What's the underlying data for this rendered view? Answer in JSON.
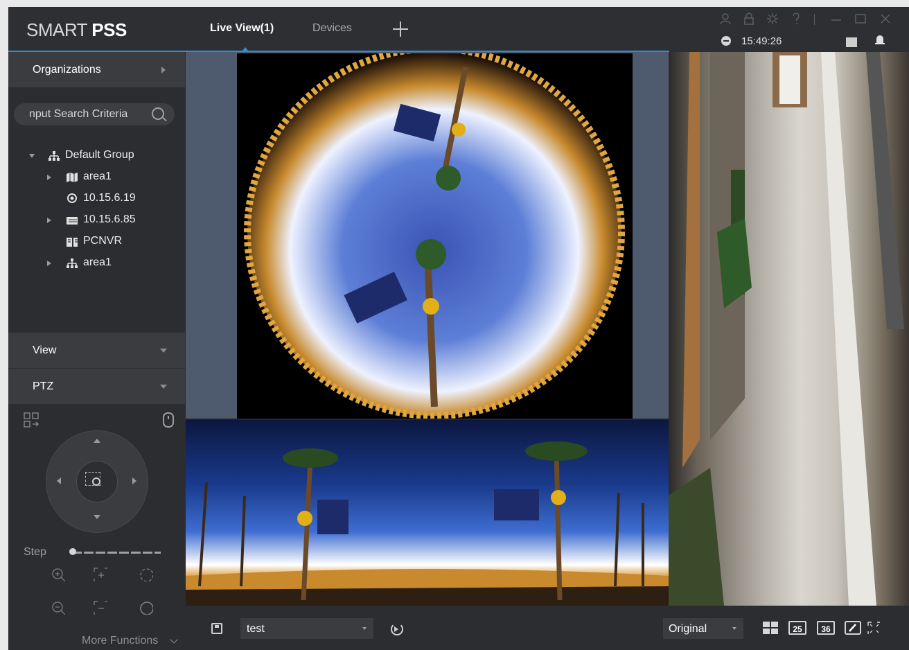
{
  "app": {
    "logo_light": "SMART ",
    "logo_bold": "PSS"
  },
  "tabs": [
    {
      "label": "Live View(1)"
    },
    {
      "label": "Devices"
    }
  ],
  "status": {
    "time": "15:49:26"
  },
  "sidebar": {
    "organizations_label": "Organizations",
    "search": {
      "placeholder": "nput Search Criteria"
    },
    "tree": [
      {
        "label": "Default Group",
        "icon": "group-icon",
        "expanded": true
      },
      {
        "label": "area1",
        "icon": "map-icon"
      },
      {
        "label": "10.15.6.19",
        "icon": "camera-icon"
      },
      {
        "label": "10.15.6.85",
        "icon": "nvr-device-icon"
      },
      {
        "label": "PCNVR",
        "icon": "pcnvr-icon"
      },
      {
        "label": "area1",
        "icon": "group-icon"
      }
    ],
    "view_label": "View",
    "ptz_label": "PTZ",
    "step_label": "Step",
    "step_value": 0,
    "more_functions_label": "More Functions"
  },
  "bottombar": {
    "view_value": "test",
    "stream_value": "Original",
    "layout_25": "25",
    "layout_36": "36"
  },
  "colors": {
    "accent": "#2e8cd8",
    "background": "#2b2d30",
    "panel": "#3a3c40"
  }
}
